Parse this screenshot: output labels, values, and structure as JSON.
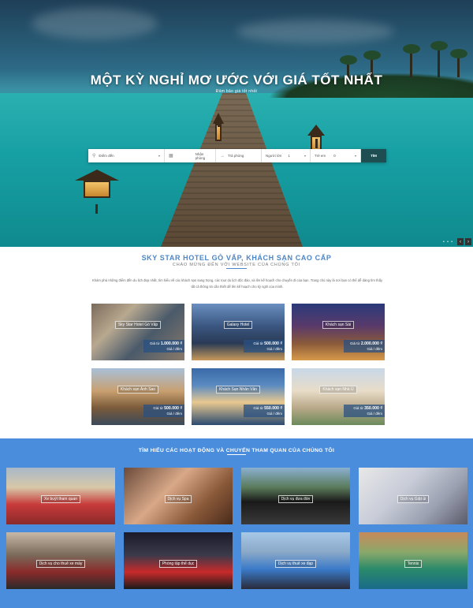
{
  "hero": {
    "title": "MỘT KỲ NGHỈ MƠ ƯỚC VỚI GIÁ TỐT NHẤT",
    "subtitle": "Đảm bảo giá tốt nhất",
    "search": {
      "destination_placeholder": "Điểm đến",
      "checkin_placeholder": "Nhận phòng",
      "checkout_placeholder": "Trả phòng",
      "adults_label": "Người lớn",
      "adults_value": "1",
      "children_label": "Trẻ em",
      "children_value": "0",
      "search_button": "TÌM"
    },
    "slider_dots": "• • •",
    "prev_arrow": "‹",
    "next_arrow": "›"
  },
  "intro": {
    "title": "SKY STAR HOTEL GÒ VẤP, KHÁCH SẠN CAO CẤP",
    "subtitle": "CHÀO MỪNG ĐẾN VỚI WEBSITE CỦA CHÚNG TÔI",
    "text": "Khám phá những điểm đến du lịch đẹp nhất, tìm hiểu về các khách sạn sang trọng, các tour du lịch độc đáo, và lên kế hoạch cho chuyến đi của bạn. Trang chủ này là nơi bạn có thể dễ dàng tìm thấy tất cả thông tin cần thiết để lên kế hoạch cho kỳ nghỉ của mình."
  },
  "hotels": [
    {
      "name": "Sky Star Hotel Gò Vấp",
      "price_prefix": "Giá từ",
      "price": "1.000.000 ₫",
      "unit": "Giá / đêm"
    },
    {
      "name": "Galaxy Hotel",
      "price_prefix": "Giá từ",
      "price": "500.000 ₫",
      "unit": "Giá / đêm"
    },
    {
      "name": "Khách sạn Sài",
      "price_prefix": "Giá từ",
      "price": "2.000.000 ₫",
      "unit": "Giá / đêm"
    },
    {
      "name": "Khách sạn Ánh Sao",
      "price_prefix": "Giá từ",
      "price": "500.000 ₫",
      "unit": "Giá / đêm"
    },
    {
      "name": "Khách Sạn Nhân Văn",
      "price_prefix": "Giá từ",
      "price": "550.000 ₫",
      "unit": "Giá / đêm"
    },
    {
      "name": "Khách sạn Nhà Ú",
      "price_prefix": "Giá từ",
      "price": "350.000 ₫",
      "unit": "Giá / đêm"
    }
  ],
  "activities": {
    "title": "TÌM HIỂU CÁC HOẠT ĐỘNG VÀ CHUYẾN THAM QUAN CỦA CHÚNG TÔI",
    "items": [
      {
        "label": "Xe buýt tham quan"
      },
      {
        "label": "Dịch vụ Spa"
      },
      {
        "label": "Dịch vụ đưa đón"
      },
      {
        "label": "Dịch vụ Giặt ủi"
      },
      {
        "label": "Dịch vụ cho thuê xe máy"
      },
      {
        "label": "Phòng tập thể dục"
      },
      {
        "label": "Dịch vụ thuê xe đạp"
      },
      {
        "label": "Tennis"
      }
    ]
  }
}
